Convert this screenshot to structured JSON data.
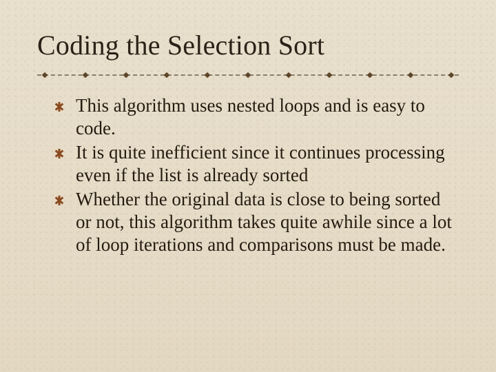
{
  "slide": {
    "title": "Coding the Selection Sort",
    "bullets": [
      "This algorithm uses nested loops and is easy to code.",
      "It is quite inefficient since it continues processing even if the list is already sorted",
      "Whether the original data is close to being sorted or not, this algorithm takes quite awhile since a lot of loop iterations and comparisons must be made."
    ]
  }
}
